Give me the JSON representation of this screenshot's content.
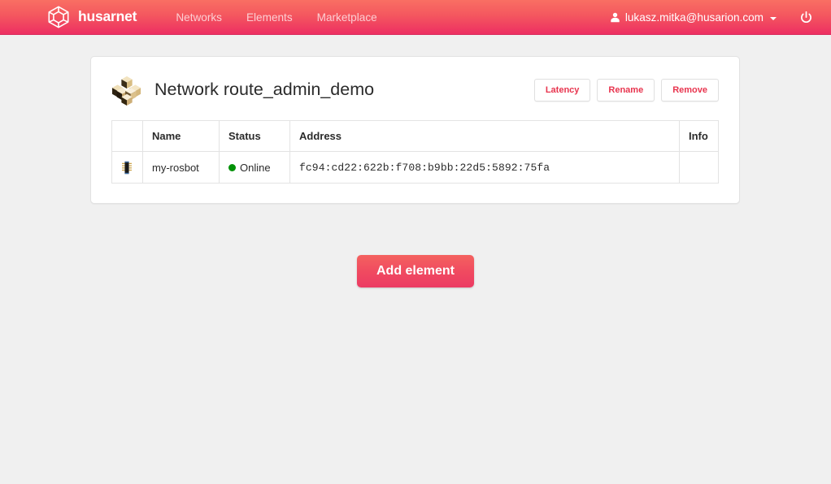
{
  "navbar": {
    "brand": {
      "text": "husarnet",
      "icon": "cube-hexagon-logo-icon"
    },
    "links": [
      {
        "label": "Networks"
      },
      {
        "label": "Elements"
      },
      {
        "label": "Marketplace"
      }
    ],
    "user": {
      "email": "lukasz.mitka@husarion.com",
      "icon": "user-icon",
      "caret": "caret-down-icon"
    },
    "logout": {
      "icon": "power-icon"
    },
    "colors": {
      "gradient_top": "#f96f63",
      "gradient_bottom": "#ed2f62"
    }
  },
  "panel": {
    "icon": "network-cubes-icon",
    "title": "Network route_admin_demo",
    "actions": [
      {
        "label": "Latency"
      },
      {
        "label": "Rename"
      },
      {
        "label": "Remove"
      }
    ],
    "table": {
      "headers": [
        "",
        "Name",
        "Status",
        "Address",
        "Info"
      ],
      "rows": [
        {
          "icon": "microchip-icon",
          "name": "my-rosbot",
          "status": "Online",
          "status_color": "#009107",
          "address": "fc94:cd22:622b:f708:b9bb:22d5:5892:75fa",
          "info": ""
        }
      ]
    }
  },
  "footer": {
    "add_element_label": "Add element",
    "accent": "#ee3a62"
  }
}
